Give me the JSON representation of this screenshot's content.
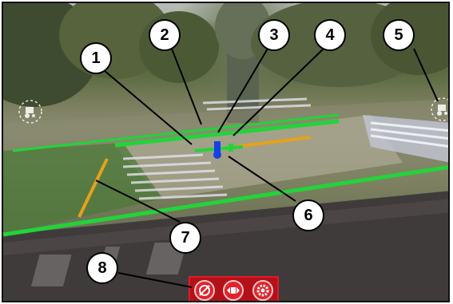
{
  "callouts": [
    {
      "id": "1",
      "label": "1"
    },
    {
      "id": "2",
      "label": "2"
    },
    {
      "id": "3",
      "label": "3"
    },
    {
      "id": "4",
      "label": "4"
    },
    {
      "id": "5",
      "label": "5"
    },
    {
      "id": "6",
      "label": "6"
    },
    {
      "id": "7",
      "label": "7"
    },
    {
      "id": "8",
      "label": "8"
    }
  ],
  "hud": {
    "left_icon": "tractor-hud-icon",
    "right_icon": "tractor-hud-icon"
  },
  "button_bar": {
    "buttons": [
      {
        "name": "no-steering-button",
        "icon": "crossed-circle-icon"
      },
      {
        "name": "width-adjust-button",
        "icon": "width-arrows-icon"
      },
      {
        "name": "settings-button",
        "icon": "gear-icon"
      }
    ]
  },
  "colors": {
    "guide_line_green": "#22d43a",
    "guide_line_orange": "#e6a21c",
    "target_marker_blue": "#1640e8",
    "button_bar_red": "#b3111a",
    "callout_border": "#000000"
  }
}
